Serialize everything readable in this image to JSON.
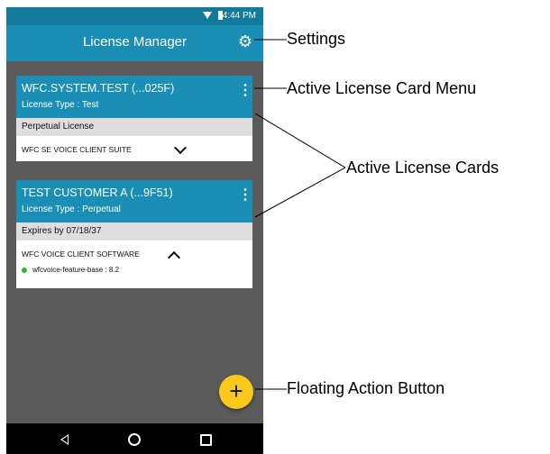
{
  "status_bar": {
    "time": "4:44 PM"
  },
  "app_bar": {
    "title": "License Manager"
  },
  "cards": [
    {
      "name": "WFC.SYSTEM.TEST (...025F)",
      "license_type": "License Type : Test",
      "license_info": "Perpetual License",
      "product": "WFC SE VOICE CLIENT SUITE",
      "expanded": false
    },
    {
      "name": "TEST CUSTOMER A (...9F51)",
      "license_type": "License Type : Perpetual",
      "license_info": "Expires by 07/18/37",
      "product": "WFC VOICE CLIENT SOFTWARE",
      "expanded": true,
      "features": [
        "wfcvoice-feature-base : 8.2"
      ]
    }
  ],
  "fab": {
    "symbol": "+"
  },
  "callouts": {
    "settings": "Settings",
    "card_menu": "Active License Card Menu",
    "cards": "Active License Cards",
    "fab": "Floating Action Button"
  },
  "colors": {
    "status_bar": "#147a9b",
    "app_bar": "#1b8eb5",
    "content_bg": "#5b5b5b",
    "fab": "#fbc91c",
    "feature_dot": "#2eb82e"
  },
  "icons": [
    "wifi-icon",
    "battery-icon",
    "gear-icon",
    "more-vert-icon",
    "chevron-down-icon",
    "chevron-up-icon",
    "add-icon",
    "back-icon",
    "home-icon",
    "recents-icon"
  ]
}
